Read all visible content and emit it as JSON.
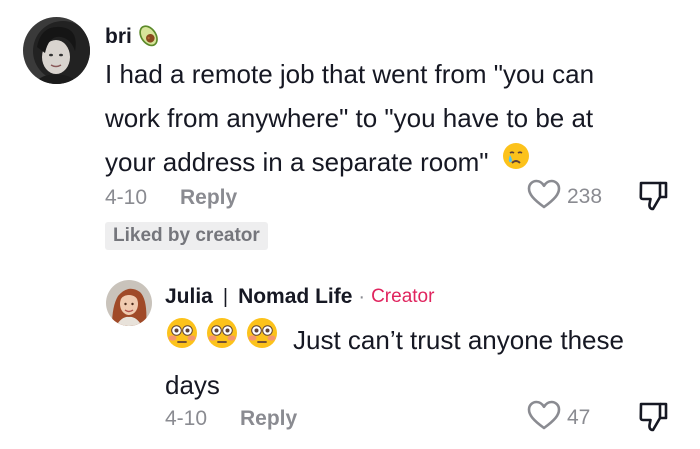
{
  "comment": {
    "username": "bri",
    "username_emoji": "avocado-icon",
    "text_line1": "I had a remote job that went from \"you can",
    "text_line2": "work from anywhere\" to \"you have to be at",
    "text_line3": "your address in a separate room\"",
    "text_emoji": "sad-tear-face-icon",
    "date": "4-10",
    "reply_label": "Reply",
    "like_count": "238",
    "liked_badge": "Liked by creator"
  },
  "reply": {
    "username": "Julia",
    "separator": "|",
    "channel": "Nomad Life",
    "dot": "·",
    "role": "Creator",
    "emojis": [
      "flushed-face-icon",
      "flushed-face-icon",
      "flushed-face-icon"
    ],
    "text_line1": "Just can’t trust anyone these",
    "text_line2": "days",
    "date": "4-10",
    "reply_label": "Reply",
    "like_count": "47"
  },
  "colors": {
    "creator": "#e0245e",
    "muted": "#8a8b91",
    "text": "#161823"
  }
}
